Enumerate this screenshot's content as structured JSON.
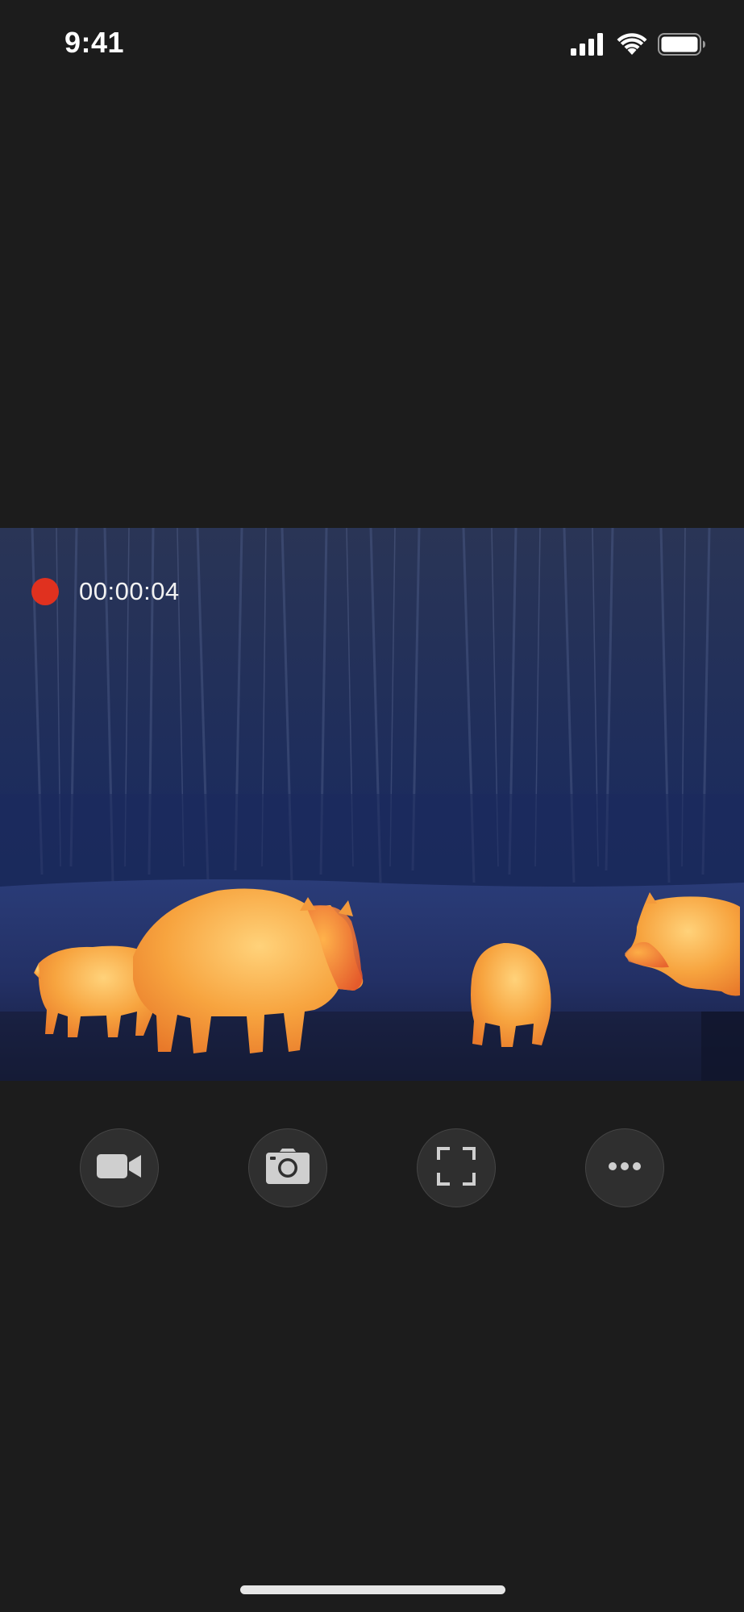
{
  "status_bar": {
    "time": "9:41",
    "icons": [
      "cellular-signal-icon",
      "wifi-icon",
      "battery-icon"
    ]
  },
  "viewport": {
    "recording_time": "00:00:04",
    "recording_indicator_color": "#e0311f",
    "content": "thermal-camera-feed"
  },
  "controls": [
    {
      "name": "record-video-button",
      "icon": "video-camera-icon"
    },
    {
      "name": "take-photo-button",
      "icon": "camera-icon"
    },
    {
      "name": "fullscreen-button",
      "icon": "fullscreen-icon"
    },
    {
      "name": "more-options-button",
      "icon": "more-dots-icon"
    }
  ],
  "colors": {
    "background": "#1c1c1c",
    "button_bg": "#2f2f2f",
    "icon": "#cfcfcf"
  }
}
